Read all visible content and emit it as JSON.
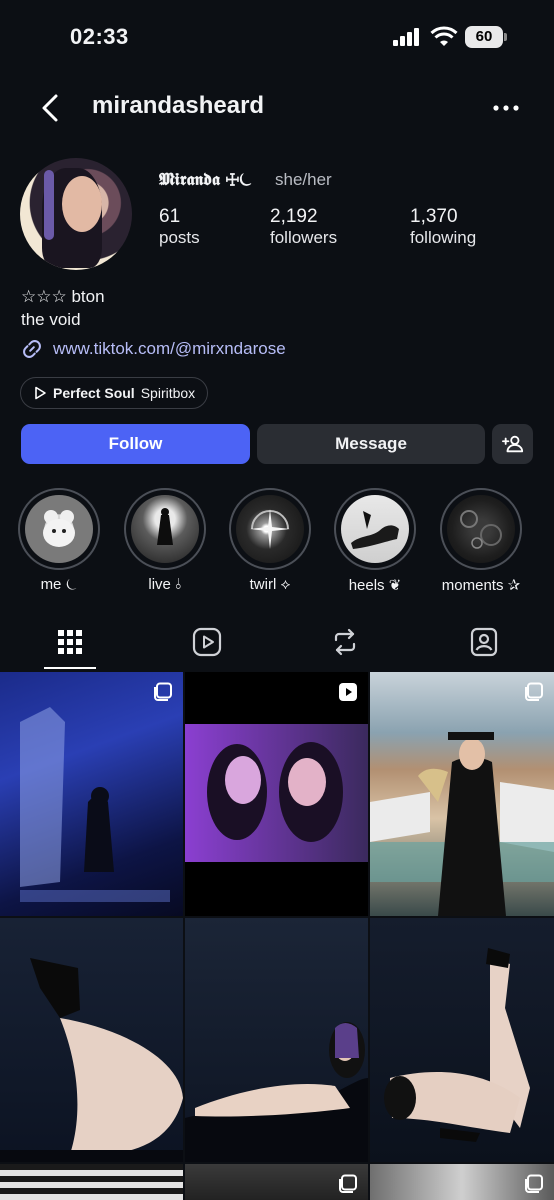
{
  "status": {
    "time": "02:33",
    "battery": "60"
  },
  "header": {
    "username": "mirandasheard"
  },
  "profile": {
    "display_name": "𝕸𝖎𝖗𝖆𝖓𝖉𝖆 ☩⏾",
    "pronouns": "she/her",
    "stats": [
      {
        "value": "61",
        "label": "posts"
      },
      {
        "value": "2,192",
        "label": "followers"
      },
      {
        "value": "1,370",
        "label": "following"
      }
    ],
    "bio_lines": [
      "☆☆☆ bton",
      "the void"
    ],
    "link": "www.tiktok.com/@mirxndarose",
    "music": {
      "title": "Perfect Soul",
      "artist": "Spiritbox"
    }
  },
  "actions": {
    "follow": "Follow",
    "message": "Message"
  },
  "highlights": [
    {
      "label": "me ⏾"
    },
    {
      "label": "live ⫰"
    },
    {
      "label": "twirl ⟡"
    },
    {
      "label": "heels ❦"
    },
    {
      "label": "moments ✰"
    }
  ],
  "tabs": [
    "grid-icon",
    "reels-icon",
    "reposts-icon",
    "tagged-icon"
  ],
  "colors": {
    "accent": "#4c63f5",
    "background": "#0c0f14",
    "link": "#b7bdf7"
  }
}
